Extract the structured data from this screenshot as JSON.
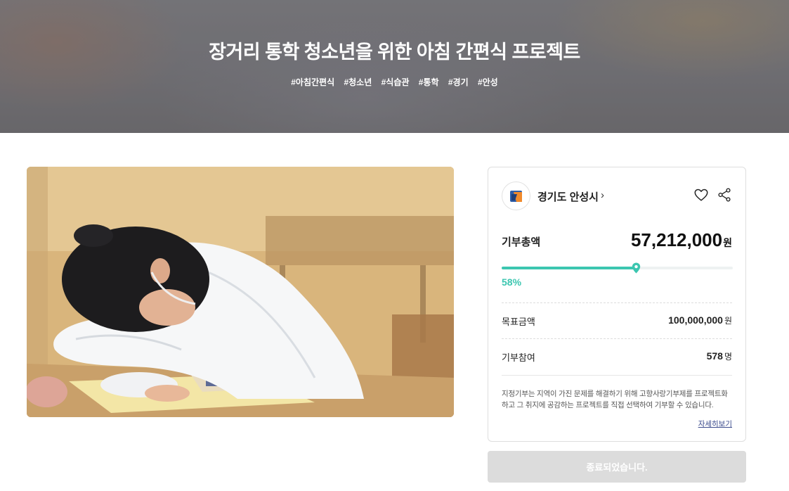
{
  "hero": {
    "title": "장거리 통학 청소년을 위한 아침 간편식 프로젝트",
    "tags": [
      "#아침간편식",
      "#청소년",
      "#식습관",
      "#통학",
      "#경기",
      "#안성"
    ]
  },
  "card": {
    "org_name": "경기도 안성시",
    "org_chevron": "›",
    "icons": {
      "logo": "city-logo-icon",
      "like": "heart-icon",
      "share": "share-icon"
    },
    "total_label": "기부총액",
    "total_value": "57,212,000",
    "total_unit": "원",
    "progress_fraction": 0.58,
    "progress_percent_text": "58%",
    "goal_label": "목표금액",
    "goal_value": "100,000,000",
    "goal_unit": "원",
    "participants_label": "기부참여",
    "participants_value": "578",
    "participants_unit": "명",
    "note_line1": "지정기부는 지역이 가진 문제를 해결하기 위해 고향사랑기부제를 프로젝트화",
    "note_line2": "하고 그 취지에 공감하는 프로젝트를 직접 선택하여 기부할 수 있습니다.",
    "more_link": "자세히보기"
  },
  "end_button": "종료되었습니다.",
  "colors": {
    "accent": "#3cc6b0",
    "button_disabled": "#dcdcdc",
    "link": "#3a4a8c"
  }
}
